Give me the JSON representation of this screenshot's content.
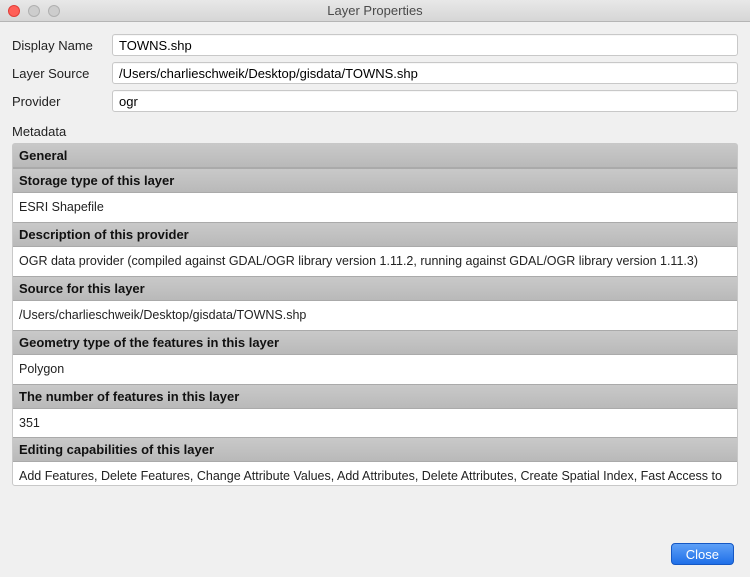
{
  "window": {
    "title": "Layer Properties"
  },
  "form": {
    "display_name": {
      "label": "Display Name",
      "value": "TOWNS.shp"
    },
    "layer_source": {
      "label": "Layer Source",
      "value": "/Users/charlieschweik/Desktop/gisdata/TOWNS.shp"
    },
    "provider": {
      "label": "Provider",
      "value": "ogr"
    }
  },
  "metadata_label": "Metadata",
  "metadata": [
    {
      "header": "General",
      "value": null
    },
    {
      "header": "Storage type of this layer",
      "value": "ESRI Shapefile"
    },
    {
      "header": "Description of this provider",
      "value": "OGR data provider (compiled against GDAL/OGR library version 1.11.2, running against GDAL/OGR library version 1.11.3)"
    },
    {
      "header": "Source for this layer",
      "value": "/Users/charlieschweik/Desktop/gisdata/TOWNS.shp"
    },
    {
      "header": "Geometry type of the features in this layer",
      "value": "Polygon"
    },
    {
      "header": "The number of features in this layer",
      "value": "351"
    },
    {
      "header": "Editing capabilities of this layer",
      "value": "Add Features, Delete Features, Change Attribute Values, Add Attributes, Delete Attributes, Create Spatial Index, Fast Access to Features at ID, Change Geometries, Simplify Geometries, Simplify Geometries with topological validation"
    }
  ],
  "buttons": {
    "close": "Close"
  }
}
